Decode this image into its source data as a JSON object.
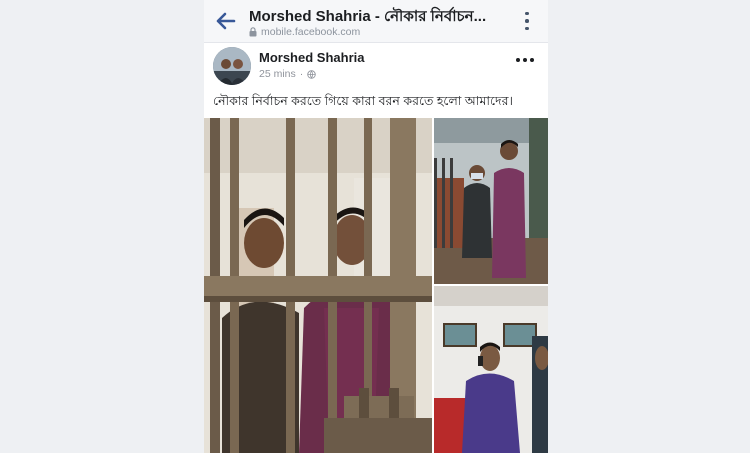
{
  "header": {
    "title": "Morshed Shahria - নৌকার নির্বাচন...",
    "url": "mobile.facebook.com",
    "back_icon": "arrow-left-icon",
    "menu_icon": "vertical-dots-icon",
    "lock_icon": "lock-icon"
  },
  "post": {
    "author": "Morshed Shahria",
    "time": "25 mins",
    "audience_icon": "globe-icon",
    "menu_icon": "horizontal-dots-icon",
    "text": "নৌকার নির্বাচন করতে গিয়ে কারা বরন করতে হলো আমাদের।"
  },
  "photos": {
    "count": 3
  },
  "colors": {
    "background": "#eef0f3",
    "accent": "#385898",
    "text": "#1c1e21",
    "muted": "#90949c"
  }
}
